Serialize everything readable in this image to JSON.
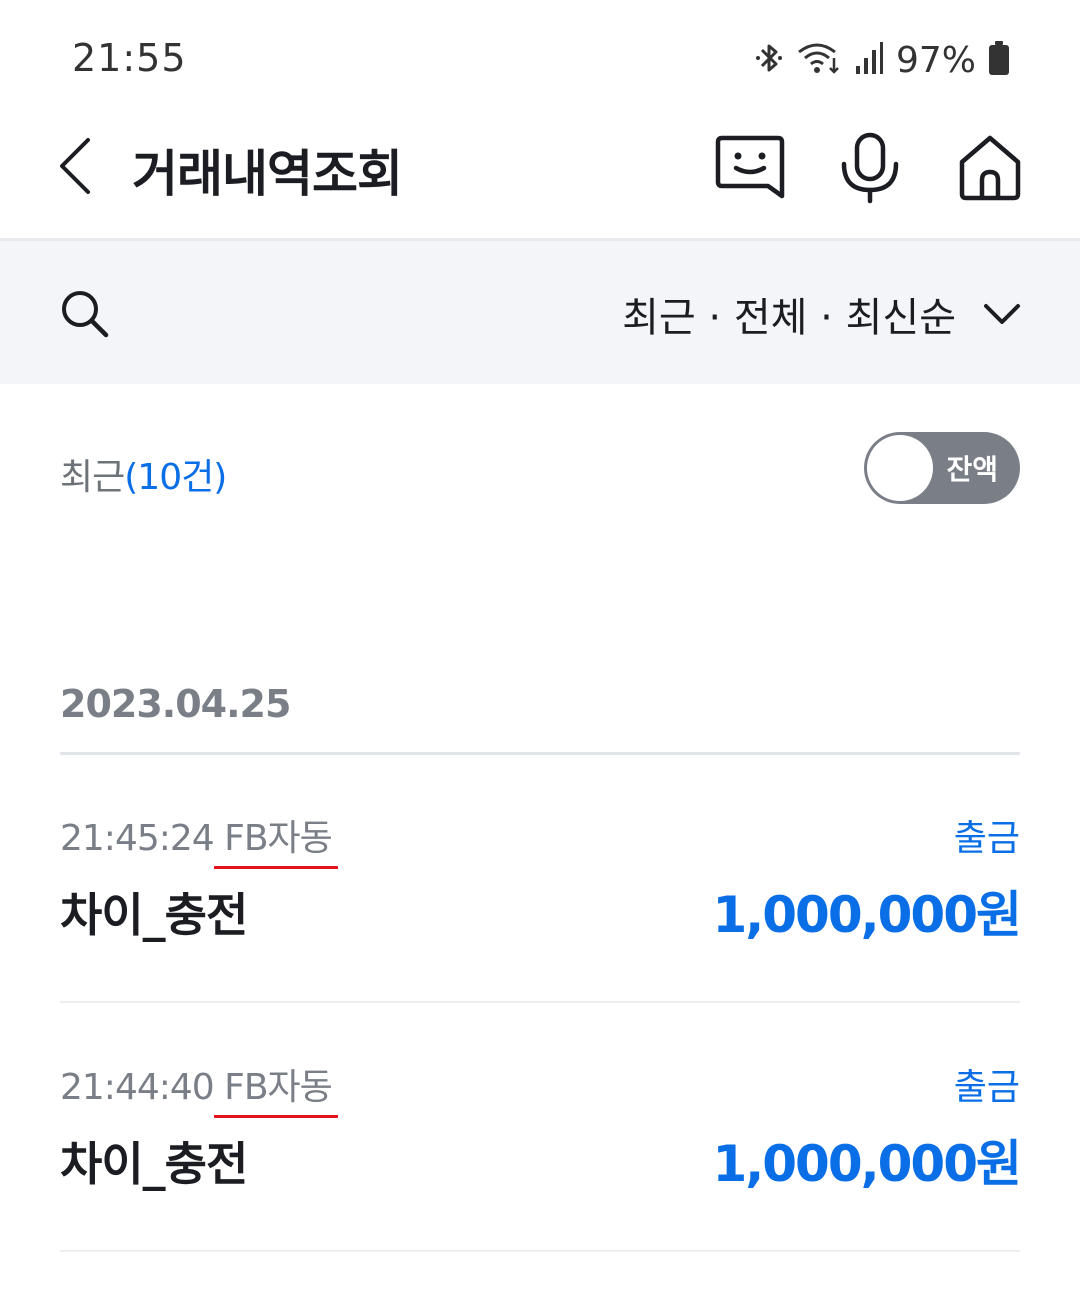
{
  "status_bar": {
    "time": "21:55",
    "battery": "97%",
    "icons": [
      "bluetooth-icon",
      "wifi-icon",
      "signal-icon",
      "battery-icon"
    ]
  },
  "header": {
    "title": "거래내역조회",
    "icons": [
      "back-icon",
      "chatbot-icon",
      "microphone-icon",
      "home-icon"
    ]
  },
  "filter": {
    "label": "최근 · 전체 · 최신순"
  },
  "summary": {
    "label": "최근",
    "count": "(10건)",
    "balance_toggle_label": "잔액",
    "balance_toggle_on": false
  },
  "groups": [
    {
      "date": "2023.04.25",
      "transactions": [
        {
          "time": "21:45:24",
          "channel": "FB자동",
          "type": "출금",
          "name": "차이_충전",
          "amount": "1,000,000원"
        },
        {
          "time": "21:44:40",
          "channel": "FB자동",
          "type": "출금",
          "name": "차이_충전",
          "amount": "1,000,000원"
        }
      ]
    }
  ],
  "colors": {
    "accent_blue": "#0a6fe6",
    "filter_bg": "#f3f5f9",
    "muted_text": "#7a7f87",
    "annotation_red": "#e0141e"
  }
}
